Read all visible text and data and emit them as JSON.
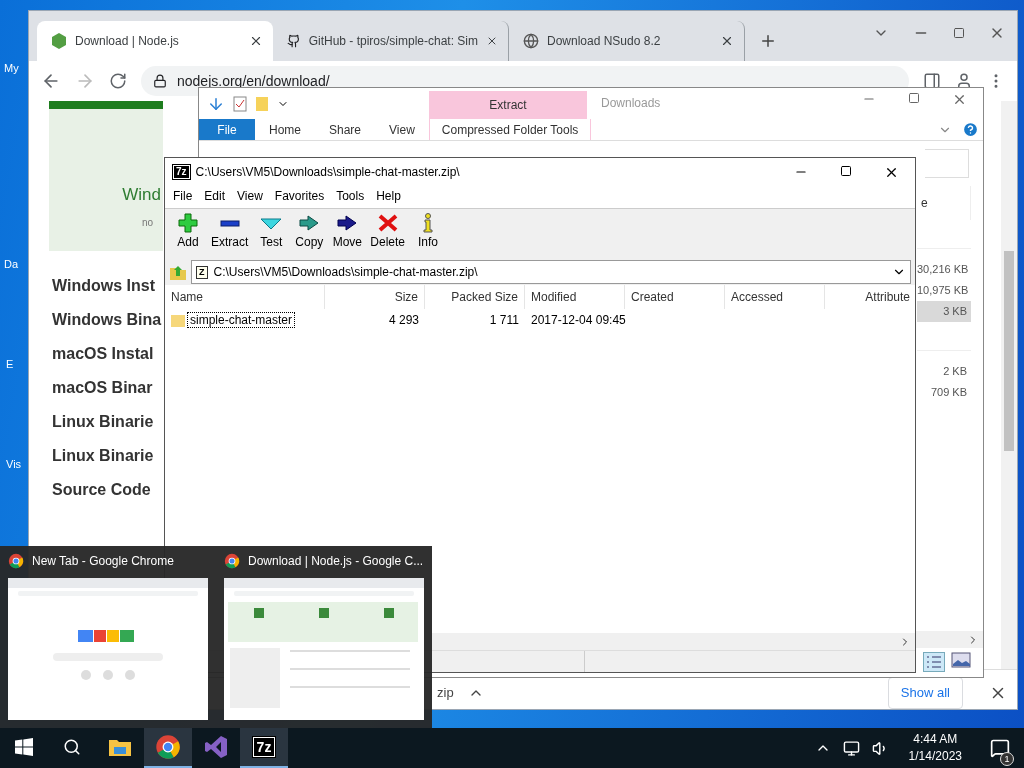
{
  "desktop": {
    "icon_labels": [
      "My",
      "Da",
      "E",
      "Vis"
    ]
  },
  "browser": {
    "tabs": [
      {
        "title": "Download | Node.js",
        "selected": true,
        "kind": "node"
      },
      {
        "title": "GitHub - tpiros/simple-chat: Sim",
        "selected": false,
        "kind": "github"
      },
      {
        "title": "Download NSudo 8.2",
        "selected": false,
        "kind": "globe"
      }
    ],
    "url": "nodejs.org/en/download/",
    "page": {
      "card_title": "Wind",
      "card_note": "no",
      "links": [
        "Windows Inst",
        "Windows Bina",
        "macOS Instal",
        "macOS Binar",
        "Linux Binarie",
        "Linux Binarie",
        "Source Code"
      ]
    },
    "download_bar": {
      "file": "zip",
      "button": "Show all"
    }
  },
  "explorer": {
    "title": "Downloads",
    "context_tab": "Extract",
    "ribbon_tabs": [
      {
        "label": "File",
        "selected": true
      },
      {
        "label": "Home",
        "selected": false
      },
      {
        "label": "Share",
        "selected": false
      },
      {
        "label": "View",
        "selected": false
      },
      {
        "label": "Compressed Folder Tools",
        "selected": false
      }
    ],
    "column_fragment": "e",
    "groups": [
      [
        {
          "size": "30,216 KB",
          "selected": false
        },
        {
          "size": "10,975 KB",
          "selected": false
        },
        {
          "size": "3 KB",
          "selected": true
        }
      ],
      [
        {
          "size": "2 KB",
          "selected": false
        },
        {
          "size": "709 KB",
          "selected": false
        }
      ]
    ]
  },
  "sevenzip": {
    "logo": "7z",
    "title": "C:\\Users\\VM5\\Downloads\\simple-chat-master.zip\\",
    "menu": [
      "File",
      "Edit",
      "View",
      "Favorites",
      "Tools",
      "Help"
    ],
    "toolbar": [
      {
        "label": "Add",
        "kind": "add"
      },
      {
        "label": "Extract",
        "kind": "extract"
      },
      {
        "label": "Test",
        "kind": "test"
      },
      {
        "label": "Copy",
        "kind": "copy"
      },
      {
        "label": "Move",
        "kind": "move"
      },
      {
        "label": "Delete",
        "kind": "delete"
      },
      {
        "label": "Info",
        "kind": "info"
      }
    ],
    "path_logo": "Z",
    "path": "C:\\Users\\VM5\\Downloads\\simple-chat-master.zip\\",
    "columns": [
      "Name",
      "Size",
      "Packed Size",
      "Modified",
      "Created",
      "Accessed",
      "Attribute"
    ],
    "rows": [
      {
        "name": "simple-chat-master",
        "size": "4 293",
        "packed_size": "1 711",
        "modified": "2017-12-04 09:45",
        "focused": true
      }
    ]
  },
  "taskbar": {
    "previews": [
      {
        "title": "New Tab - Google Chrome"
      },
      {
        "title": "Download | Node.js - Google C..."
      }
    ],
    "apps": [
      {
        "kind": "explorer",
        "active": false
      },
      {
        "kind": "chrome",
        "active": true
      },
      {
        "kind": "vs",
        "active": false
      },
      {
        "kind": "sevenzip",
        "active": true,
        "label": "7z"
      }
    ],
    "clock": {
      "time": "4:44 AM",
      "date": "1/14/2023"
    },
    "notification_count": "1"
  }
}
